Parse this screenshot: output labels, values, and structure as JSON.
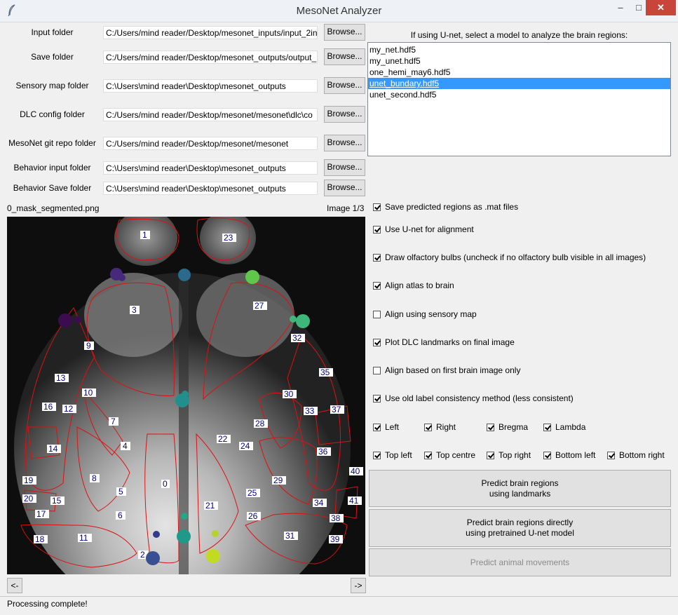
{
  "window": {
    "title": "MesoNet Analyzer",
    "minimize": "–",
    "maximize": "□",
    "close": "✕"
  },
  "fields": [
    {
      "label": "Input folder",
      "value": "C:/Users/mind reader/Desktop/mesonet_inputs/input_2in",
      "button": "Browse..."
    },
    {
      "label": "Save folder",
      "value": "C:/Users/mind reader/Desktop/mesonet_outputs/output_",
      "button": "Browse..."
    },
    {
      "label": "Sensory map folder",
      "value": "C:\\Users\\mind reader\\Desktop\\mesonet_outputs",
      "button": "Browse..."
    },
    {
      "label": "DLC config folder",
      "value": "C:/Users/mind reader/Desktop/mesonet/mesonet\\dlc\\co",
      "button": "Browse..."
    },
    {
      "label": "MesoNet git repo folder",
      "value": "C:/Users/mind reader/Desktop/mesonet/mesonet",
      "button": "Browse..."
    },
    {
      "label": "Behavior input folder",
      "value": "C:\\Users\\mind reader\\Desktop\\mesonet_outputs",
      "button": "Browse..."
    },
    {
      "label": "Behavior Save folder",
      "value": "C:\\Users\\mind reader\\Desktop\\mesonet_outputs",
      "button": "Browse..."
    }
  ],
  "model": {
    "prompt": "If using U-net, select a model to analyze the brain regions:",
    "items": [
      "my_net.hdf5",
      "my_unet.hdf5",
      "one_hemi_may6.hdf5",
      "unet_bundary.hdf5",
      "unet_second.hdf5"
    ],
    "selected_index": 3
  },
  "image": {
    "filename": "0_mask_segmented.png",
    "counter": "Image 1/3",
    "prev": "<-",
    "next": "->",
    "region_labels": [
      "1",
      "2",
      "3",
      "4",
      "5",
      "6",
      "7",
      "8",
      "9",
      "10",
      "11",
      "12",
      "13",
      "14",
      "15",
      "16",
      "17",
      "18",
      "19",
      "20",
      "21",
      "22",
      "23",
      "24",
      "25",
      "26",
      "27",
      "28",
      "29",
      "30",
      "31",
      "32",
      "33",
      "34",
      "35",
      "36",
      "37",
      "38",
      "39",
      "40",
      "41",
      "0"
    ]
  },
  "options": [
    {
      "label": "Save predicted regions as .mat files",
      "checked": true
    },
    {
      "label": "Use U-net for alignment",
      "checked": true
    },
    {
      "label": "Draw olfactory bulbs (uncheck if no olfactory bulb visible in all images)",
      "checked": true
    },
    {
      "label": "Align atlas to brain",
      "checked": true
    },
    {
      "label": "Align using sensory map",
      "checked": false
    },
    {
      "label": "Plot DLC landmarks on final image",
      "checked": true
    },
    {
      "label": "Align based on first brain image only",
      "checked": false
    },
    {
      "label": "Use old label consistency method (less consistent)",
      "checked": true
    }
  ],
  "landmarks_row1": [
    {
      "label": "Left",
      "checked": true
    },
    {
      "label": "Right",
      "checked": true
    },
    {
      "label": "Bregma",
      "checked": true
    },
    {
      "label": "Lambda",
      "checked": true
    }
  ],
  "landmarks_row2": [
    {
      "label": "Top left",
      "checked": true
    },
    {
      "label": "Top centre",
      "checked": true
    },
    {
      "label": "Top right",
      "checked": true
    },
    {
      "label": "Bottom left",
      "checked": true
    },
    {
      "label": "Bottom right",
      "checked": true
    }
  ],
  "actions": {
    "predict_landmarks_line1": "Predict brain regions",
    "predict_landmarks_line2": "using landmarks",
    "predict_unet_line1": "Predict brain regions directly",
    "predict_unet_line2": "using pretrained U-net model",
    "predict_movements": "Predict animal movements"
  },
  "status": "Processing complete!"
}
